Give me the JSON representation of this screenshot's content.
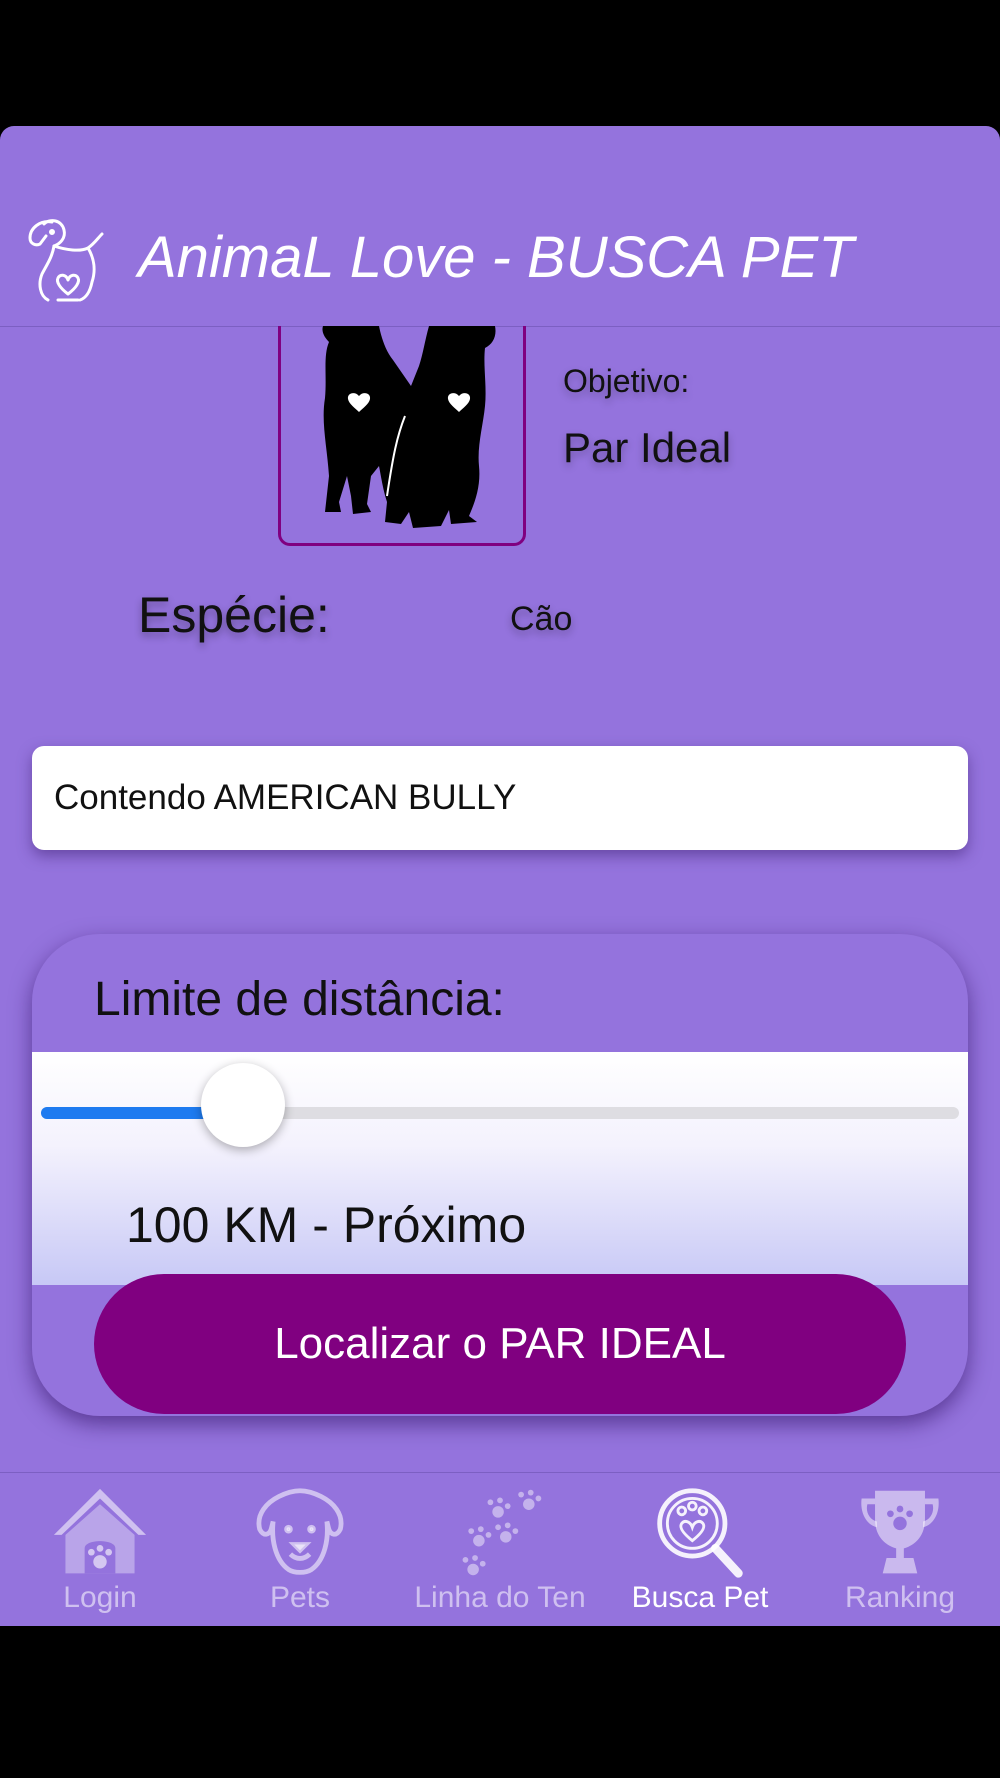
{
  "header": {
    "title": "AnimaL Love - BUSCA PET",
    "logo_icon": "dog-heart-icon"
  },
  "pet": {
    "photo_icon": "two-dogs-silhouette-icon",
    "objective_label": "Objetivo:",
    "objective_value": "Par Ideal",
    "species_label": "Espécie:",
    "species_value": "Cão"
  },
  "breed_filter": {
    "value": "Contendo AMERICAN BULLY"
  },
  "distance": {
    "title": "Limite de distância:",
    "slider_fraction": 0.22,
    "value_text": "100 KM - Próximo",
    "find_button": "Localizar o PAR IDEAL"
  },
  "tabs": [
    {
      "label": "Login",
      "icon": "doghouse-icon",
      "active": false
    },
    {
      "label": "Pets",
      "icon": "dog-face-icon",
      "active": false
    },
    {
      "label": "Linha do Ten",
      "icon": "paw-prints-icon",
      "active": false
    },
    {
      "label": "Busca Pet",
      "icon": "search-paw-icon",
      "active": true
    },
    {
      "label": "Ranking",
      "icon": "trophy-icon",
      "active": false
    }
  ],
  "colors": {
    "background": "#9473DD",
    "accent": "#800080",
    "slider": "#1E7BF0"
  }
}
